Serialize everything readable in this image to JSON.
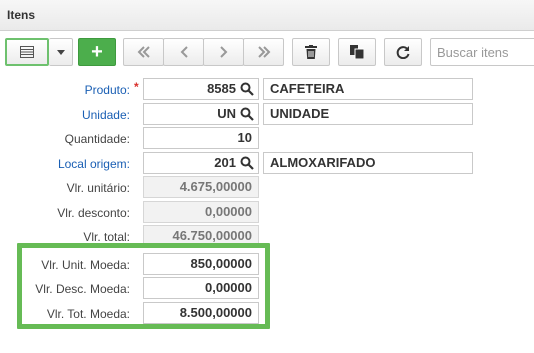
{
  "window": {
    "title": "Itens"
  },
  "toolbar": {
    "search_placeholder": "Buscar itens",
    "add_label": "+"
  },
  "form": {
    "produto": {
      "label": "Produto:",
      "required_mark": "*",
      "code": "8585",
      "description": "CAFETEIRA"
    },
    "unidade": {
      "label": "Unidade:",
      "code": "UN",
      "description": "UNIDADE"
    },
    "quantidade": {
      "label": "Quantidade:",
      "value": "10"
    },
    "local_origem": {
      "label": "Local origem:",
      "code": "201",
      "description": "ALMOXARIFADO"
    },
    "vlr_unitario": {
      "label": "Vlr. unitário:",
      "value": "4.675,00000"
    },
    "vlr_desconto": {
      "label": "Vlr. desconto:",
      "value": "0,00000"
    },
    "vlr_total": {
      "label": "Vlr. total:",
      "value": "46.750,00000"
    },
    "vlr_unit_moeda": {
      "label": "Vlr. Unit. Moeda:",
      "value": "850,00000"
    },
    "vlr_desc_moeda": {
      "label": "Vlr. Desc. Moeda:",
      "value": "0,00000"
    },
    "vlr_tot_moeda": {
      "label": "Vlr. Tot. Moeda:",
      "value": "8.500,00000"
    }
  },
  "colors": {
    "highlight": "#66bb55",
    "link": "#1a5fb4",
    "add_button": "#4cae4c",
    "required": "#d9302c"
  },
  "icons": [
    "grid-icon",
    "caret-down-icon",
    "plus-icon",
    "first-icon",
    "prev-icon",
    "next-icon",
    "last-icon",
    "trash-icon",
    "copy-icon",
    "refresh-icon",
    "search-icon"
  ]
}
